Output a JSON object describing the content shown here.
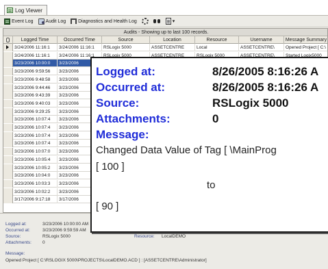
{
  "tab": {
    "label": "Log Viewer"
  },
  "toolbar": {
    "event_log": "Event Log",
    "audit_log": "Audit Log",
    "diagnostics": "Diagnostics and Health Log"
  },
  "grid": {
    "caption": "Audits - Showing up to last 100 records.",
    "columns": [
      "Logged Time",
      "Occurred Time",
      "Source",
      "Location",
      "Resource",
      "Username",
      "Message Summary"
    ],
    "rows": [
      {
        "logged": "3/24/2006 11:16:1",
        "occurred": "3/24/2006 11:16:1",
        "source": "RSLogix 5000",
        "location": "ASSETCENTRE",
        "resource": "Local",
        "username": "ASSETCENTRE\\",
        "summary": "Opened Project [ C:\\"
      },
      {
        "logged": "3/24/2006 11:16:1",
        "occurred": "3/24/2006 11:16:1",
        "source": "RSLogix 5000",
        "location": "ASSETCENTRE",
        "resource": "RSLogix 5000",
        "username": "ASSETCENTRE\\",
        "summary": "Started Logix5000"
      },
      {
        "logged": "3/23/2006 10:00:0",
        "occurred": "3/23/2006",
        "source": "",
        "location": "",
        "resource": "",
        "username": "",
        "summary": ""
      },
      {
        "logged": "3/23/2006 9:59:56",
        "occurred": "3/23/2006",
        "source": "",
        "location": "",
        "resource": "",
        "username": "",
        "summary": ""
      },
      {
        "logged": "3/23/2006 9:48:58",
        "occurred": "3/23/2006",
        "source": "",
        "location": "",
        "resource": "",
        "username": "",
        "summary": ""
      },
      {
        "logged": "3/23/2006 9:44:46",
        "occurred": "3/23/2006",
        "source": "",
        "location": "",
        "resource": "",
        "username": "",
        "summary": ""
      },
      {
        "logged": "3/23/2006 9:43:39",
        "occurred": "3/23/2006",
        "source": "",
        "location": "",
        "resource": "",
        "username": "",
        "summary": ""
      },
      {
        "logged": "3/23/2006 9:40:03",
        "occurred": "3/23/2006",
        "source": "",
        "location": "",
        "resource": "",
        "username": "",
        "summary": ""
      },
      {
        "logged": "3/23/2006 9:29:25",
        "occurred": "3/23/2006",
        "source": "",
        "location": "",
        "resource": "",
        "username": "",
        "summary": ""
      },
      {
        "logged": "3/23/2006 10:07:4",
        "occurred": "3/23/2006",
        "source": "",
        "location": "",
        "resource": "",
        "username": "",
        "summary": ""
      },
      {
        "logged": "3/23/2006 10:07:4",
        "occurred": "3/23/2006",
        "source": "",
        "location": "",
        "resource": "",
        "username": "",
        "summary": ""
      },
      {
        "logged": "3/23/2006 10:07:4",
        "occurred": "3/23/2006",
        "source": "",
        "location": "",
        "resource": "",
        "username": "",
        "summary": ""
      },
      {
        "logged": "3/23/2006 10:07:4",
        "occurred": "3/23/2006",
        "source": "",
        "location": "",
        "resource": "",
        "username": "",
        "summary": ""
      },
      {
        "logged": "3/23/2006 10:07:0",
        "occurred": "3/23/2006",
        "source": "",
        "location": "",
        "resource": "",
        "username": "",
        "summary": ""
      },
      {
        "logged": "3/23/2006 10:05:4",
        "occurred": "3/23/2006",
        "source": "",
        "location": "",
        "resource": "",
        "username": "",
        "summary": ""
      },
      {
        "logged": "3/23/2006 10:05:2",
        "occurred": "3/23/2006",
        "source": "",
        "location": "",
        "resource": "",
        "username": "",
        "summary": ""
      },
      {
        "logged": "3/23/2006 10:04:0",
        "occurred": "3/23/2006",
        "source": "",
        "location": "",
        "resource": "",
        "username": "",
        "summary": ""
      },
      {
        "logged": "3/23/2006 10:03:3",
        "occurred": "3/23/2006",
        "source": "",
        "location": "",
        "resource": "",
        "username": "",
        "summary": ""
      },
      {
        "logged": "3/23/2006 10:02:2",
        "occurred": "3/23/2006",
        "source": "",
        "location": "",
        "resource": "",
        "username": "",
        "summary": ""
      },
      {
        "logged": "3/17/2006 9:17:18",
        "occurred": "3/17/2006",
        "source": "",
        "location": "",
        "resource": "",
        "username": "",
        "summary": ""
      }
    ]
  },
  "details": {
    "logged_label": "Logged at:",
    "logged_value": "3/23/2006 10:00:00 AM",
    "occurred_label": "Occurred at:",
    "occurred_value": "3/23/2006 9:59:59 AM",
    "source_label": "Source:",
    "source_value": "RSLogix 5000",
    "resource_label": "Resource:",
    "resource_value": "LocalDEMO",
    "attachments_label": "Attachments:",
    "attachments_value": "0",
    "message_label": "Message:",
    "message_value": "Opened Project [ C:\\RSLOGIX 5000\\PROJECTS\\LocalDEMO.ACD ] :  [ASSETCENTRE\\Administrator]"
  },
  "zoom": {
    "logged_label": "Logged at:",
    "logged_value": "8/26/2005 8:16:26 A",
    "occurred_label": "Occurred at:",
    "occurred_value": "8/26/2005 8:16:26 A",
    "source_label": "Source:",
    "source_value": "RSLogix 5000",
    "attachments_label": "Attachments:",
    "attachments_value": "0",
    "message_label": "Message:",
    "message_line": "Changed Data Value of Tag [ \\MainProg",
    "old_value": "[ 100 ]",
    "to_word": "to",
    "new_value": "[ 90 ]"
  },
  "colors": {
    "selection": "#315aa6",
    "zoom_label": "#1f2cd8",
    "detail_label": "#3a4a8a"
  }
}
